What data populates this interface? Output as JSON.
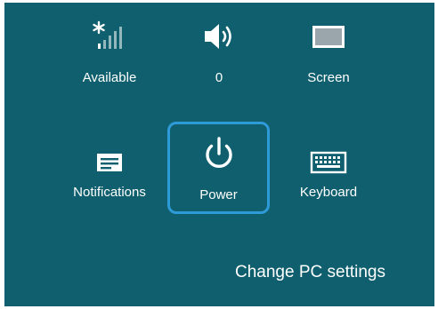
{
  "quick_settings": {
    "network": {
      "label": "Available",
      "icon": "network-signal-icon"
    },
    "volume": {
      "label": "0",
      "icon": "speaker-volume-icon"
    },
    "screen": {
      "label": "Screen",
      "icon": "screen-brightness-icon"
    },
    "notifications": {
      "label": "Notifications",
      "icon": "notifications-icon"
    },
    "power": {
      "label": "Power",
      "icon": "power-icon",
      "selected": true
    },
    "keyboard": {
      "label": "Keyboard",
      "icon": "keyboard-icon"
    }
  },
  "footer": {
    "change_settings_label": "Change PC settings"
  },
  "colors": {
    "panel_background": "#0f5f6e",
    "selection_border": "#2f9ad8",
    "foreground": "#ffffff"
  }
}
